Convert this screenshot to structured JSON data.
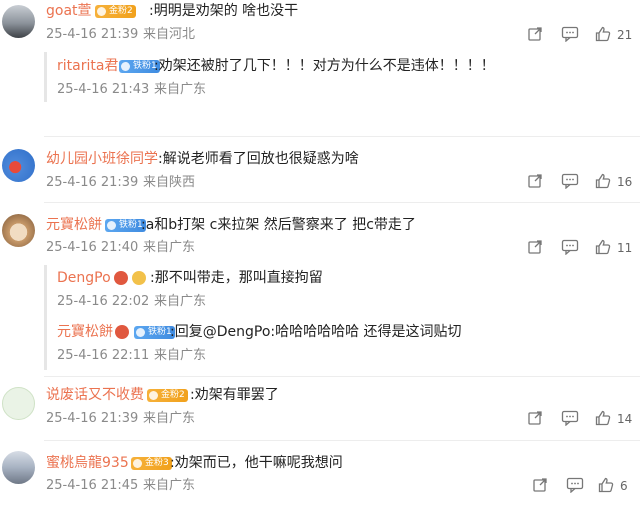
{
  "comments": [
    {
      "username": "goat萱",
      "badge": "金粉2",
      "badge_type": "gold",
      "text": ":明明是劝架的 啥也没干",
      "time": "25-4-16 21:39",
      "location": "来自河北",
      "likes": "21",
      "replies": [
        {
          "username": "ritarita君",
          "badge": "铁粉1",
          "badge_type": "blue",
          "text": ":劝架还被肘了几下！！！对方为什么不是违体！！！！",
          "time": "25-4-16 21:43",
          "location": "来自广东"
        }
      ]
    },
    {
      "username": "幼儿园小班徐同学",
      "badge": "",
      "badge_type": "",
      "text": ":解说老师看了回放也很疑惑为啥",
      "time": "25-4-16 21:39",
      "location": "来自陕西",
      "likes": "16",
      "replies": []
    },
    {
      "username": "元寶松餅",
      "badge": "铁粉1",
      "badge_type": "blue",
      "text": ":a和b打架 c来拉架 然后警察来了 把c带走了",
      "time": "25-4-16 21:40",
      "location": "来自广东",
      "likes": "11",
      "replies": [
        {
          "username": "DengPo",
          "badge": "",
          "badge_type": "",
          "text": ":那不叫带走，那叫直接拘留",
          "time": "25-4-16 22:02",
          "location": "来自广东"
        },
        {
          "username": "元寶松餅",
          "badge": "铁粉1",
          "badge_type": "blue",
          "text": ":回复@DengPo:哈哈哈哈哈哈 还得是这词贴切",
          "time": "25-4-16 22:11",
          "location": "来自广东"
        }
      ]
    },
    {
      "username": "说废话又不收费",
      "badge": "金粉2",
      "badge_type": "gold",
      "text": ":劝架有罪罢了",
      "time": "25-4-16 21:39",
      "location": "来自广东",
      "likes": "14",
      "replies": []
    },
    {
      "username": "蜜桃烏龍935",
      "badge": "金粉3",
      "badge_type": "gold",
      "text": ":劝架而已，他干嘛呢我想问",
      "time": "25-4-16 21:45",
      "location": "来自广东",
      "likes": "6",
      "replies": []
    }
  ],
  "colors": {
    "username": "#eb7350",
    "meta": "#8a8a8a",
    "gold_badge": "#f1a11c",
    "blue_badge": "#3f8be0"
  },
  "icons": [
    "share-icon",
    "comment-icon",
    "like-icon",
    "verified-icon",
    "emoji-icon"
  ]
}
